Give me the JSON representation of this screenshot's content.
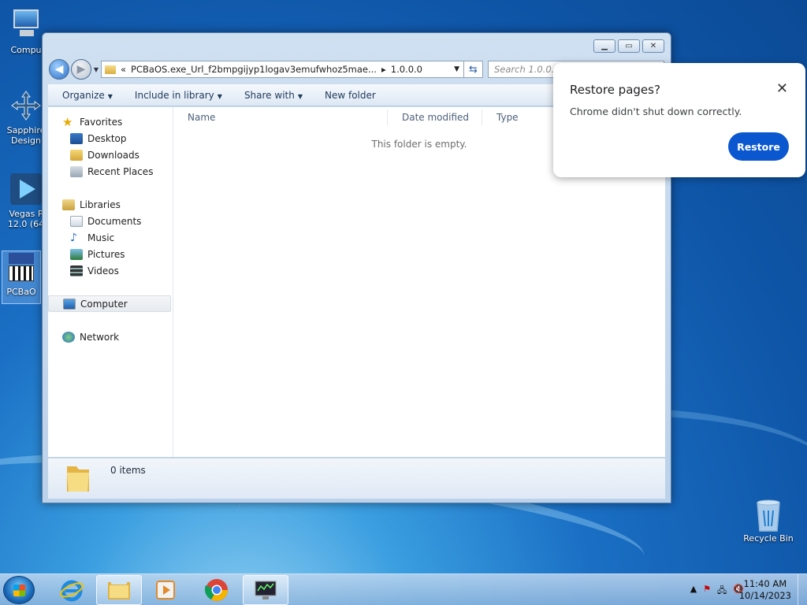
{
  "desktop": {
    "icons": [
      {
        "label": "Compu"
      },
      {
        "label": "Sapphire\nDesign"
      },
      {
        "label": "Vegas P\n12.0 (64"
      },
      {
        "label": "PCBaO"
      },
      {
        "label": "Recycle Bin"
      }
    ]
  },
  "explorer": {
    "breadcrumb_prefix": "«",
    "breadcrumb_folder": "PCBaOS.exe_Url_f2bmpgijyp1logav3emufwhoz5mae...",
    "breadcrumb_sep": "▸",
    "breadcrumb_leaf": "1.0.0.0",
    "search_placeholder": "Search 1.0.0.0",
    "toolbar": {
      "organize": "Organize",
      "include": "Include in library",
      "share": "Share with",
      "new_folder": "New folder"
    },
    "nav": {
      "favorites": "Favorites",
      "desktop": "Desktop",
      "downloads": "Downloads",
      "recent": "Recent Places",
      "libraries": "Libraries",
      "documents": "Documents",
      "music": "Music",
      "pictures": "Pictures",
      "videos": "Videos",
      "computer": "Computer",
      "network": "Network"
    },
    "columns": {
      "name": "Name",
      "date": "Date modified",
      "type": "Type"
    },
    "empty_message": "This folder is empty.",
    "status_items": "0 items"
  },
  "chrome_popup": {
    "title": "Restore pages?",
    "message": "Chrome didn't shut down correctly.",
    "button": "Restore",
    "close": "✕",
    "accent": "#0b57d0"
  },
  "taskbar": {
    "time": "11:40 AM",
    "date": "10/14/2023"
  }
}
